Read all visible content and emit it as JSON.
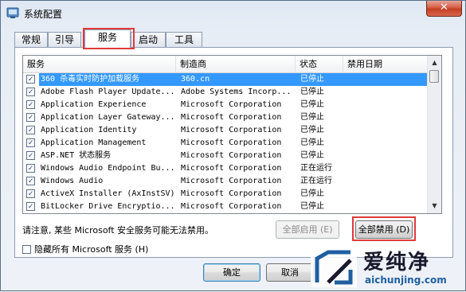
{
  "window": {
    "title": "系统配置",
    "close": "✕"
  },
  "tabs": [
    "常规",
    "引导",
    "服务",
    "启动",
    "工具"
  ],
  "active_tab": 2,
  "grid": {
    "columns": [
      "服务",
      "制造商",
      "状态",
      "禁用日期"
    ],
    "rows": [
      {
        "checked": true,
        "name": "360 杀毒实时防护加载服务",
        "vendor": "360.cn",
        "status": "已停止",
        "date": "",
        "selected": true
      },
      {
        "checked": true,
        "name": "Adobe Flash Player Update...",
        "vendor": "Adobe Systems Incorp...",
        "status": "已停止",
        "date": ""
      },
      {
        "checked": true,
        "name": "Application Experience",
        "vendor": "Microsoft Corporation",
        "status": "已停止",
        "date": ""
      },
      {
        "checked": true,
        "name": "Application Layer Gateway...",
        "vendor": "Microsoft Corporation",
        "status": "已停止",
        "date": ""
      },
      {
        "checked": true,
        "name": "Application Identity",
        "vendor": "Microsoft Corporation",
        "status": "已停止",
        "date": ""
      },
      {
        "checked": true,
        "name": "Application Management",
        "vendor": "Microsoft Corporation",
        "status": "已停止",
        "date": ""
      },
      {
        "checked": true,
        "name": "ASP.NET 状态服务",
        "vendor": "Microsoft Corporation",
        "status": "已停止",
        "date": ""
      },
      {
        "checked": true,
        "name": "Windows Audio Endpoint Bu...",
        "vendor": "Microsoft Corporation",
        "status": "正在运行",
        "date": ""
      },
      {
        "checked": true,
        "name": "Windows Audio",
        "vendor": "Microsoft Corporation",
        "status": "正在运行",
        "date": ""
      },
      {
        "checked": true,
        "name": "ActiveX Installer (AxInstSV)",
        "vendor": "Microsoft Corporation",
        "status": "已停止",
        "date": ""
      },
      {
        "checked": true,
        "name": "BitLocker Drive Encryptio...",
        "vendor": "Microsoft Corporation",
        "status": "已停止",
        "date": ""
      }
    ]
  },
  "note": "请注意, 某些 Microsoft 安全服务可能无法禁用。",
  "buttons": {
    "enable_all": "全部启用 (E)",
    "disable_all": "全部禁用 (D)",
    "ok": "确定",
    "cancel": "取消"
  },
  "hide_ms_label": "隐藏所有 Microsoft 服务 (H)",
  "watermark": {
    "cn": "爱纯净",
    "en": "aichunjing.com"
  },
  "colors": {
    "selection": "#3399ff",
    "highlight": "#e03a3a"
  }
}
